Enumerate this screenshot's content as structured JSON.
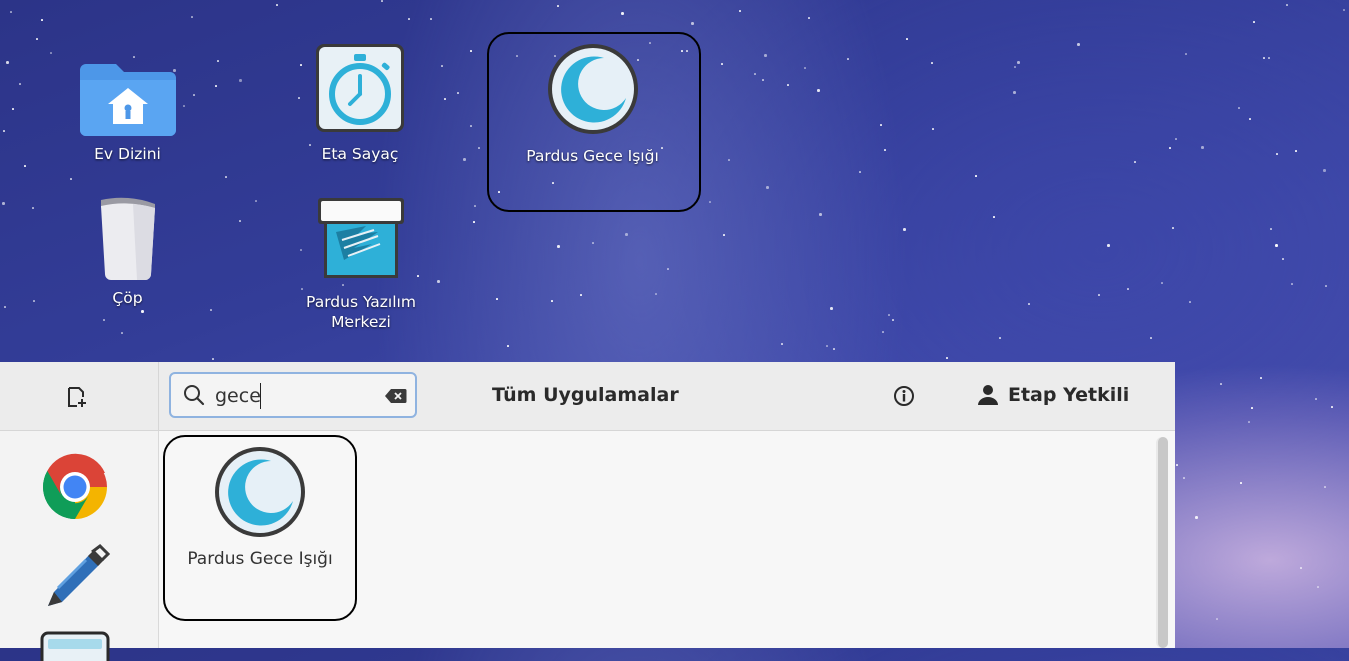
{
  "desktop": {
    "icons": [
      {
        "label": "Ev Dizini"
      },
      {
        "label": "Eta Sayaç"
      },
      {
        "label": "Pardus Gece Işığı"
      },
      {
        "label": "Çöp"
      },
      {
        "label": "Pardus Yazılım Merkezi"
      }
    ]
  },
  "launcher": {
    "new_window_icon": "add-page-icon",
    "search": {
      "value": "gece",
      "clear_icon": "backspace-clear-icon",
      "search_icon": "magnifier-icon"
    },
    "title": "Tüm Uygulamalar",
    "info_icon": "info-icon",
    "user": {
      "name": "Etap Yetkili",
      "icon": "person-icon"
    },
    "sidebar": [
      {
        "icon": "chrome-icon"
      },
      {
        "icon": "pen-icon"
      },
      {
        "icon": "window-icon"
      }
    ],
    "results": [
      {
        "label": "Pardus Gece Işığı"
      }
    ]
  },
  "colors": {
    "accent": "#2eb0d8",
    "moon_light": "#e6f0f7",
    "selection": "#000000"
  }
}
